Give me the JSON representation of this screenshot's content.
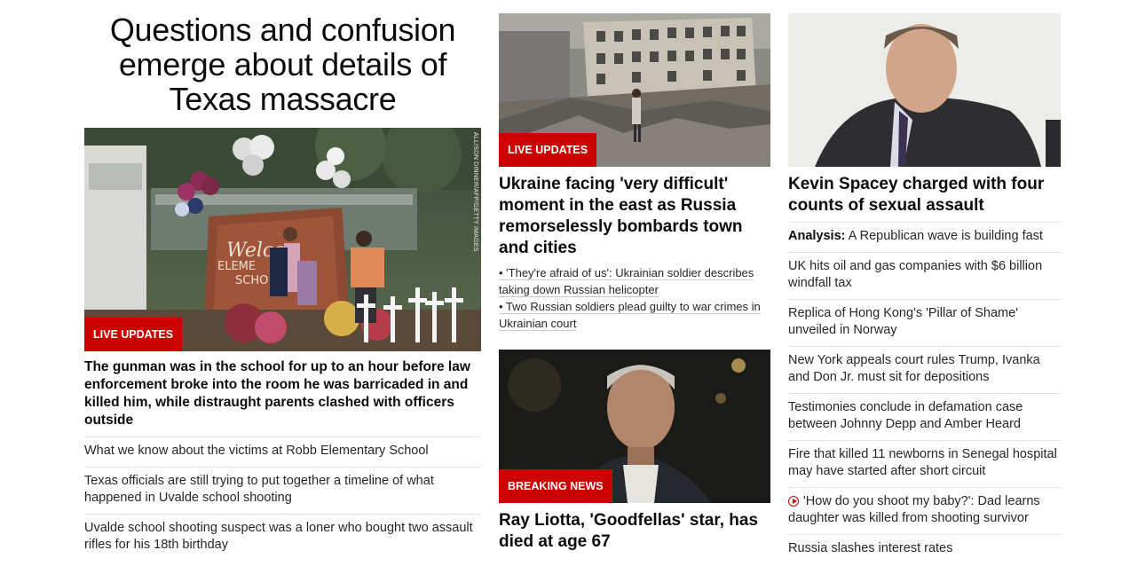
{
  "lead": {
    "headline": "Questions and confusion emerge about details of Texas massacre",
    "image_credit": "ALLISON DINNER/AFP/GETTY IMAGES",
    "badge": "LIVE UPDATES",
    "summary": "The gunman was in the school for up to an hour before law enforcement broke into the room he was barricaded in and killed him, while distraught parents clashed with officers outside",
    "links": [
      "What we know about the victims at Robb Elementary School",
      "Texas officials are still trying to put together a timeline of what happened in Uvalde school shooting",
      "Uvalde school shooting suspect was a loner who bought two assault rifles for his 18th birthday"
    ]
  },
  "ukraine": {
    "badge": "LIVE UPDATES",
    "headline": "Ukraine facing 'very difficult' moment in the east as Russia remorselessly bombards town and cities",
    "bullets": [
      "• 'They're afraid of us': Ukrainian soldier describes taking down Russian helicopter",
      "• Two Russian soldiers plead guilty to war crimes in Ukrainian court"
    ]
  },
  "liotta": {
    "badge": "BREAKING NEWS",
    "headline": "Ray Liotta, 'Goodfellas' star, has died at age 67"
  },
  "spacey": {
    "headline": "Kevin Spacey charged with four counts of sexual assault",
    "links": [
      {
        "prefix": "Analysis:",
        "text": " A Republican wave is building fast",
        "video": false
      },
      {
        "prefix": "",
        "text": "UK hits oil and gas companies with $6 billion windfall tax",
        "video": false
      },
      {
        "prefix": "",
        "text": "Replica of Hong Kong's 'Pillar of Shame' unveiled in Norway",
        "video": false
      },
      {
        "prefix": "",
        "text": "New York appeals court rules Trump, Ivanka and Don Jr. must sit for depositions",
        "video": false
      },
      {
        "prefix": "",
        "text": "Testimonies conclude in defamation case between Johnny Depp and Amber Heard",
        "video": false
      },
      {
        "prefix": "",
        "text": "Fire that killed 11 newborns in Senegal hospital may have started after short circuit",
        "video": false
      },
      {
        "prefix": "",
        "text": "'How do you shoot my baby?': Dad learns daughter was killed from shooting survivor",
        "video": true
      },
      {
        "prefix": "",
        "text": "Russia slashes interest rates",
        "video": false
      }
    ]
  },
  "colors": {
    "badge_red": "#cc0000"
  }
}
